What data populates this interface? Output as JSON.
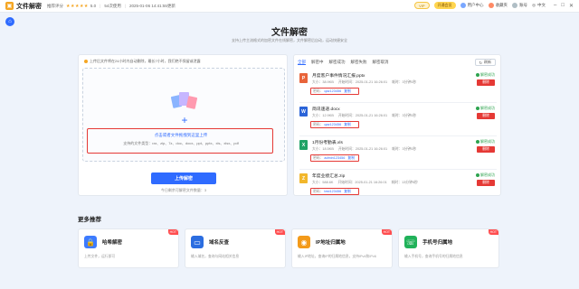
{
  "app": {
    "name": "文件解密",
    "rating_label": "推荐评分",
    "stars": "★★★★★",
    "score": "5.0",
    "uses": "54次使用",
    "datetime": "2025-01-06 14:41:55更新",
    "vip": "VIP",
    "member": "开通会员",
    "user_center": "用户中心",
    "favorites": "收藏夹",
    "account": "账号",
    "lang": "中文"
  },
  "page": {
    "title": "文件解密",
    "subtitle": "支持上传主流格式的加密文件在线解密，文件解密后自动，运动快捷安全"
  },
  "upload": {
    "tip": "上传后文件将在24小时内自动删除，最长7小时，我们绝不保留或泄露",
    "click_text": "点击或者文件拖拽到这里上传",
    "support_text": "支持的文件类型：rar、zip、7z、doc、docx、ppt、pptx、xls、xlsx、pdf",
    "button": "上传解密",
    "remaining": "今日剩余可解密文件数量：3"
  },
  "results": {
    "tabs": [
      "全部",
      "解密中",
      "解密成功",
      "解密失败",
      "解密取消"
    ],
    "refresh": "刷新",
    "size_label": "大小：",
    "time_label": "开始时间：",
    "duration_label": "耗时：",
    "pwd_label": "密码：",
    "copy": "复制",
    "status_text": "解密成功",
    "delete_text": "删除",
    "files": [
      {
        "name": "月度客户事件情况汇报.pptx",
        "icon": "P",
        "color": "#e8643a",
        "size": "38.9KB",
        "time": "2025-01-21 16:26:01",
        "duration": "3分钟5秒",
        "password": "qaz123456"
      },
      {
        "name": "简讯速递.docx",
        "icon": "W",
        "color": "#2b64d8",
        "size": "12.9KB",
        "time": "2025-01-21 16:26:01",
        "duration": "3分钟5秒",
        "password": "qaz123456"
      },
      {
        "name": "1月份考勤表.xls",
        "icon": "X",
        "color": "#21a366",
        "size": "18.5KB",
        "time": "2025-01-21 16:26:01",
        "duration": "3分钟5秒",
        "password": "admin123456"
      },
      {
        "name": "年度业绩汇总.zip",
        "icon": "Z",
        "color": "#f2b72c",
        "size": "588.6K",
        "time": "2025-01-21 16:26:01",
        "duration": "13分钟5秒",
        "password": "test123456"
      }
    ]
  },
  "more": {
    "title": "更多推荐",
    "hot": "HOT",
    "cards": [
      {
        "title": "哈希解密",
        "desc": "上传文件，运行即可",
        "color": "#3d7bff",
        "icon": "lock-icon"
      },
      {
        "title": "域名反查",
        "desc": "输入域名，查询与网站相关信息",
        "color": "#2b6de0",
        "icon": "monitor-icon"
      },
      {
        "title": "IP地址归属地",
        "desc": "输入IP地址，查询IP的归属地信息，支持IPv4和IPv6",
        "color": "#f39a1a",
        "icon": "location-icon"
      },
      {
        "title": "手机号归属地",
        "desc": "输入手机号，查询手机号的归属地信息",
        "color": "#21b25a",
        "icon": "phone-icon"
      }
    ]
  }
}
